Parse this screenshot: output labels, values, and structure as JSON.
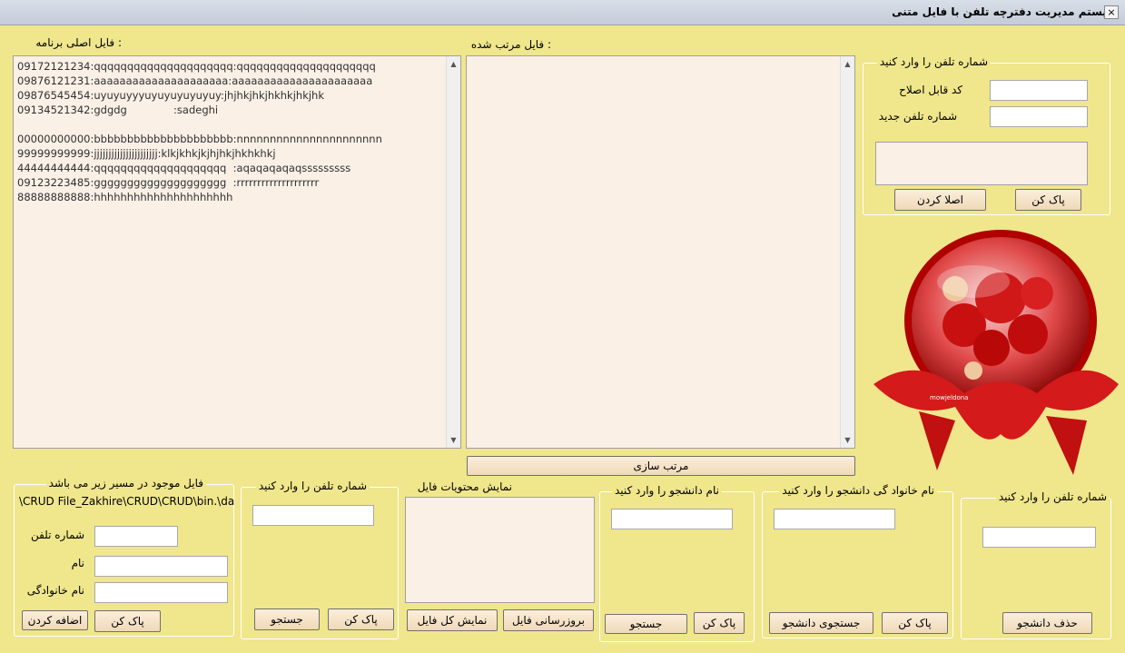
{
  "window": {
    "title": "سیستم مدیریت دفترچه تلفن با فایل متنی",
    "close_glyph": "×"
  },
  "main_file": {
    "label": ": فایل اصلی برنامه",
    "content": "09172121234:qqqqqqqqqqqqqqqqqqqqq:qqqqqqqqqqqqqqqqqqqqq\n09876121231:aaaaaaaaaaaaaaaaaaaaa:aaaaaaaaaaaaaaaaaaaaaa\n09876545454:uyuyuyyyuyuyuyuyuyuy:jhjhkjhkjhkhkjhkjhk\n09134521342:gdgdg              :sadeghi\n\n00000000000:bbbbbbbbbbbbbbbbbbbbb:nnnnnnnnnnnnnnnnnnnnnn\n99999999999:jjjjjjjjjjjjjjjjjjjjjj:klkjkhkjkjhjhkjhkhkhkj\n44444444444:qqqqqqqqqqqqqqqqqqqq  :aqaqaqaqaqsssssssss\n09123223485:gggggggggggggggggggg  :rrrrrrrrrrrrrrrrrrrr\n88888888888:hhhhhhhhhhhhhhhhhhhhh"
  },
  "sorted_file": {
    "label": ": فایل مرتب شده",
    "content": ""
  },
  "sort_button": "مرتب سازی",
  "edit_phone": {
    "title": "شماره تلفن را وارد کنید",
    "code_label": "کد قابل اصلاح",
    "code_value": "",
    "new_phone_label": "شماره تلفن جدید",
    "new_phone_value": "",
    "result_text": "",
    "clear_button": "پاک کن",
    "apply_button": "اصلا کردن"
  },
  "decoration": {
    "watermark": "mowjeldona"
  },
  "add_group": {
    "title": "فایل موجود در مسیر زیر می باشد",
    "path": "\\CRUD File_Zakhire\\CRUD\\CRUD\\bin.\\data",
    "phone_label": "شماره تلفن",
    "phone_value": "",
    "name_label": "نام",
    "name_value": "",
    "family_label": "نام خانوادگی",
    "family_value": "",
    "clear_button": "پاک کن",
    "add_button": "اضافه کردن"
  },
  "search_phone": {
    "title": "شماره تلفن  را وارد کنید",
    "value": "",
    "clear_button": "پاک کن",
    "search_button": "جستجو"
  },
  "show_file": {
    "title": "نمایش محتویات فایل",
    "content": "",
    "update_button": "بروزرسانی فایل",
    "show_all_button": "نمایش کل فایل"
  },
  "search_name": {
    "title": "نام دانشجو را وارد کنید",
    "value": "",
    "clear_button": "پاک کن",
    "search_button": "جستجو"
  },
  "search_family": {
    "title": "نام خانواد گی دانشجو را وارد کنید",
    "value": "",
    "clear_button": "پاک کن",
    "search_button": "جستجوی دانشجو"
  },
  "delete_group": {
    "title": "شماره تلفن را وارد کنید",
    "value": "",
    "delete_button": "حذف دانشجو"
  },
  "colors": {
    "form_bg": "#f0e68c",
    "textarea_bg": "#faf0e6",
    "button_bg": "#f0d9b8",
    "rose_red": "#d41a1a"
  }
}
